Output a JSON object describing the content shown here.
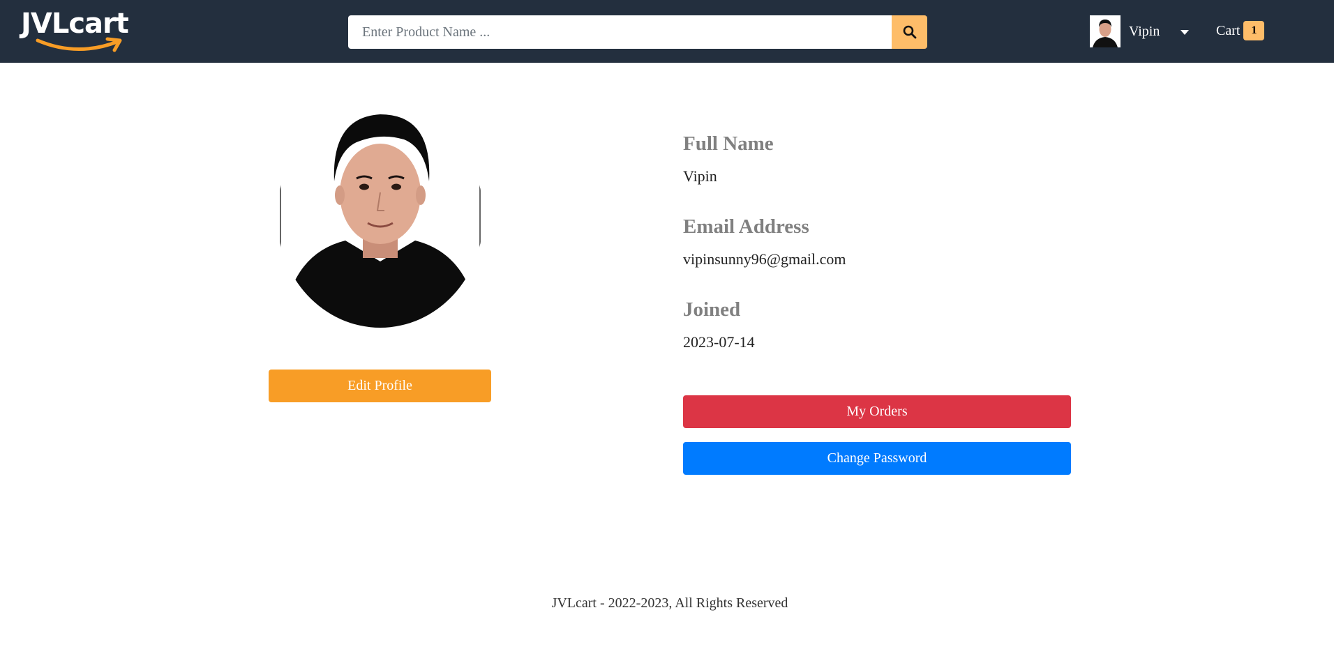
{
  "app": {
    "brand": "JVLcart",
    "brand_accent": "#f89d26",
    "navbar_bg": "#232f3e"
  },
  "search": {
    "placeholder": "Enter Product Name ...",
    "value": "",
    "icon": "search-icon"
  },
  "user_menu": {
    "name": "Vipin",
    "avatar_icon": "user-avatar",
    "dropdown_icon": "caret-down-icon"
  },
  "cart": {
    "label": "Cart",
    "count": "1"
  },
  "profile": {
    "edit_button": "Edit Profile",
    "fields": [
      {
        "label": "Full Name",
        "value": "Vipin"
      },
      {
        "label": "Email Address",
        "value": "vipinsunny96@gmail.com"
      },
      {
        "label": "Joined",
        "value": "2023-07-14"
      }
    ],
    "my_orders_button": "My Orders",
    "change_password_button": "Change Password"
  },
  "colors": {
    "edit": "#f89d26",
    "orders": "#dc3545",
    "password": "#007bff",
    "cart_badge": "#febd69"
  },
  "footer": {
    "text": "JVLcart - 2022-2023, All Rights Reserved"
  }
}
